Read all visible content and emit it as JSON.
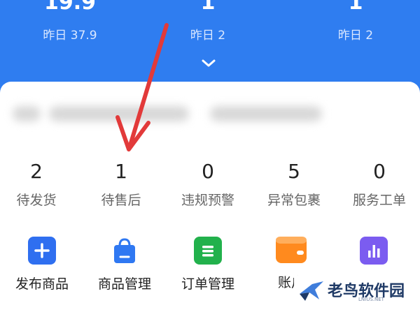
{
  "top_stats": [
    {
      "value": "19.9",
      "yesterday": "昨日 37.9"
    },
    {
      "value": "1",
      "yesterday": "昨日 2"
    },
    {
      "value": "1",
      "yesterday": "昨日 2"
    }
  ],
  "order_stats": [
    {
      "value": "2",
      "label": "待发货"
    },
    {
      "value": "1",
      "label": "待售后"
    },
    {
      "value": "0",
      "label": "违规预警"
    },
    {
      "value": "5",
      "label": "异常包裹"
    },
    {
      "value": "0",
      "label": "服务工单"
    }
  ],
  "tools": [
    {
      "label": "发布商品",
      "icon": "plus-icon",
      "color": "#2f6ff0"
    },
    {
      "label": "商品管理",
      "icon": "shopping-bag-icon",
      "color": "#2f78f2"
    },
    {
      "label": "订单管理",
      "icon": "order-list-icon",
      "color": "#22b14c"
    },
    {
      "label": "账户",
      "icon": "wallet-icon",
      "color": "#ff8a1e"
    },
    {
      "label": "",
      "icon": "bar-chart-icon",
      "color": "#7b5cf0"
    }
  ],
  "watermark": {
    "text": "老鸟软件园",
    "sub": "LNIUS.NET"
  }
}
